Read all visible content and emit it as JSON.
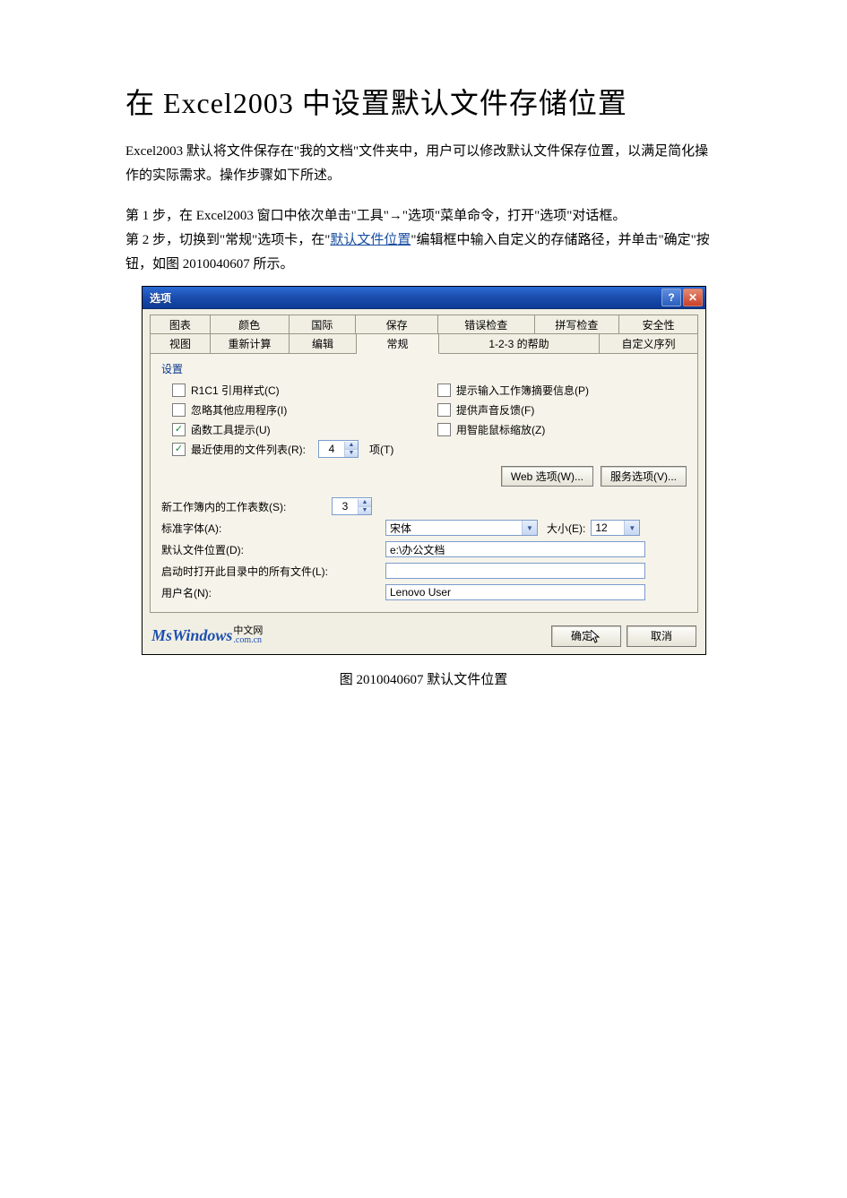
{
  "article": {
    "title": "在 Excel2003 中设置默认文件存储位置",
    "intro": "Excel2003 默认将文件保存在\"我的文档\"文件夹中，用户可以修改默认文件保存位置，以满足简化操作的实际需求。操作步骤如下所述。",
    "step1": "第 1 步，在 Excel2003 窗口中依次单击\"工具\"→\"选项\"菜单命令，打开\"选项\"对话框。",
    "step2_a": "第 2 步，切换到\"常规\"选项卡，在\"",
    "step2_link": "默认文件位置",
    "step2_b": "\"编辑框中输入自定义的存储路径，并单击\"确定\"按钮，如图 2010040607 所示。",
    "caption": "图 2010040607  默认文件位置"
  },
  "dialog": {
    "title": "选项",
    "help_btn": "?",
    "close_btn": "✕",
    "tabs_row1": [
      "图表",
      "颜色",
      "国际",
      "保存",
      "错误检查",
      "拼写检查",
      "安全性"
    ],
    "tabs_row2": [
      "视图",
      "重新计算",
      "编辑",
      "常规",
      "1-2-3 的帮助",
      "自定义序列"
    ],
    "active_tab": "常规",
    "section_settings": "设置",
    "checks_left": [
      {
        "label": "R1C1 引用样式(C)",
        "checked": false
      },
      {
        "label": "忽略其他应用程序(I)",
        "checked": false
      },
      {
        "label": "函数工具提示(U)",
        "checked": true
      },
      {
        "label": "最近使用的文件列表(R):",
        "checked": true
      }
    ],
    "recent_files_value": "4",
    "recent_files_unit": "项(T)",
    "checks_right": [
      {
        "label": "提示输入工作簿摘要信息(P)",
        "checked": false
      },
      {
        "label": "提供声音反馈(F)",
        "checked": false
      },
      {
        "label": "用智能鼠标缩放(Z)",
        "checked": false
      }
    ],
    "web_options_btn": "Web 选项(W)...",
    "service_options_btn": "服务选项(V)...",
    "sheets_label": "新工作簿内的工作表数(S):",
    "sheets_value": "3",
    "font_label": "标准字体(A):",
    "font_value": "宋体",
    "size_label": "大小(E):",
    "size_value": "12",
    "default_path_label": "默认文件位置(D):",
    "default_path_value": "e:\\办公文档",
    "startup_label": "启动时打开此目录中的所有文件(L):",
    "startup_value": "",
    "username_label": "用户名(N):",
    "username_value": "Lenovo User",
    "watermark_main": "MsWindows",
    "watermark_top": "中文网",
    "watermark_sub": ".com.cn",
    "ok_btn": "确定",
    "cancel_btn": "取消"
  }
}
